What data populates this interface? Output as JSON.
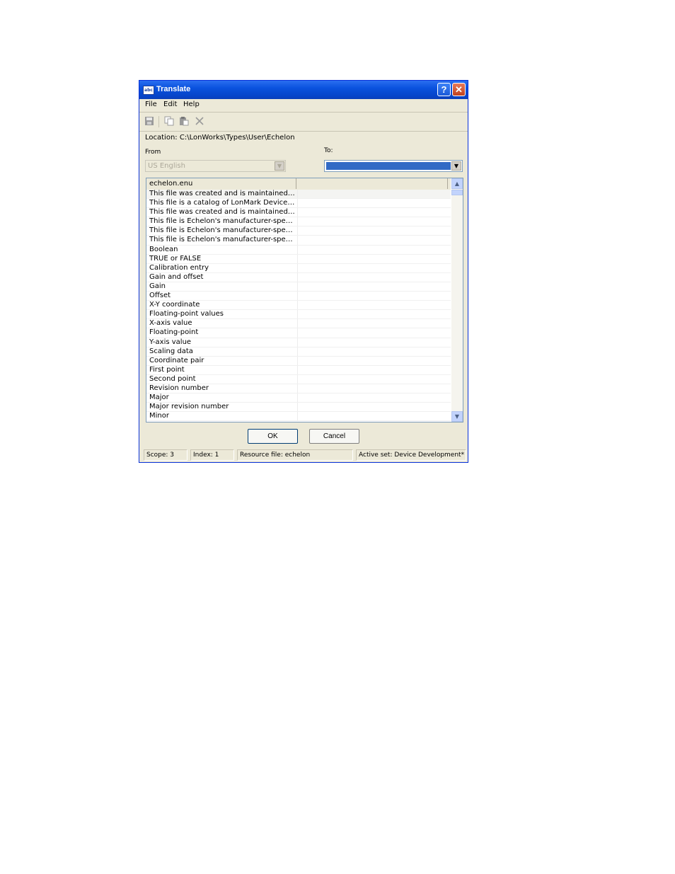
{
  "window": {
    "title": "Translate",
    "app_icon_text": "abc"
  },
  "menu": [
    "File",
    "Edit",
    "Help"
  ],
  "toolbar": [
    "save-icon",
    "copy-icon",
    "paste-icon",
    "delete-icon"
  ],
  "location": "Location: C:\\LonWorks\\Types\\User\\Echelon",
  "from": {
    "label": "From",
    "value": "US English"
  },
  "to": {
    "label": "To:",
    "value": ""
  },
  "list": {
    "columns": [
      "echelon.enu",
      ""
    ],
    "rows": [
      "This file was created and is maintained by so...",
      "This file is a catalog of LonMark Device Res...",
      "This file was created and is maintained by E...",
      "This file is Echelon's manufacturer-specific, l...",
      "This file is Echelon's manufacturer-specific ty...",
      "This file is Echelon's manufacturer-specific F...",
      "Boolean",
      "TRUE or FALSE",
      "Calibration entry",
      "Gain and offset",
      "Gain",
      "Offset",
      "X-Y coordinate",
      "Floating-point values",
      "X-axis value",
      "Floating-point",
      "Y-axis value",
      "Scaling data",
      "Coordinate pair",
      "First point",
      "Second point",
      "Revision number",
      "Major",
      "Major revision number",
      "Minor"
    ]
  },
  "buttons": {
    "ok": "OK",
    "cancel": "Cancel"
  },
  "status": {
    "scope": "Scope: 3",
    "index": "Index: 1",
    "resource": "Resource file: echelon",
    "active_set": "Active set: Device Development*"
  }
}
